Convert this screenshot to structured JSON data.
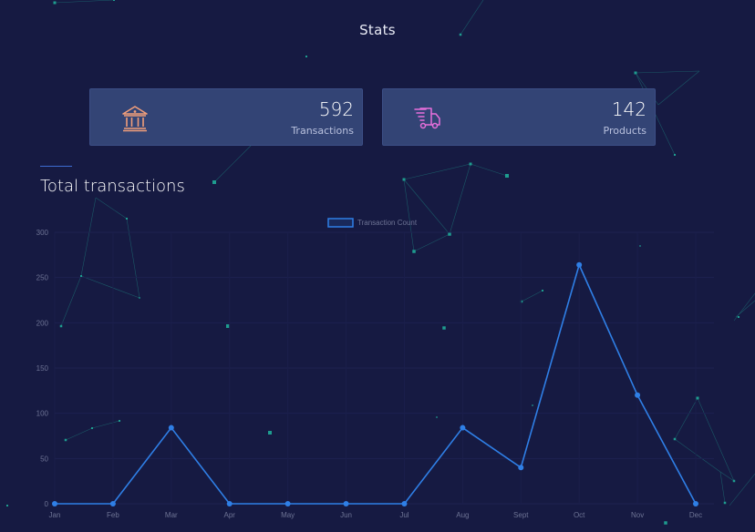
{
  "header": {
    "title": "Stats"
  },
  "stats": [
    {
      "value": "592",
      "label": "Transactions",
      "icon": "bank-icon",
      "icon_color": "#f29e7a"
    },
    {
      "value": "142",
      "label": "Products",
      "icon": "delivery-truck-icon",
      "icon_color": "#e86fdb"
    }
  ],
  "section": {
    "title": "Total transactions"
  },
  "colors": {
    "background": "#161a42",
    "card": "#334475",
    "line": "#2f7fe6",
    "network": "#1e8c86"
  },
  "chart_data": {
    "type": "line",
    "categories": [
      "Jan",
      "Feb",
      "Mar",
      "Apr",
      "May",
      "Jun",
      "Jul",
      "Aug",
      "Sept",
      "Oct",
      "Nov",
      "Dec"
    ],
    "series": [
      {
        "name": "Transaction Count",
        "values": [
          0,
          0,
          84,
          0,
          0,
          0,
          0,
          84,
          40,
          264,
          120,
          0
        ]
      }
    ],
    "yticks": [
      0,
      50,
      100,
      150,
      200,
      250,
      300
    ],
    "ylim": [
      0,
      300
    ],
    "grid": true,
    "legend_position": "top"
  }
}
